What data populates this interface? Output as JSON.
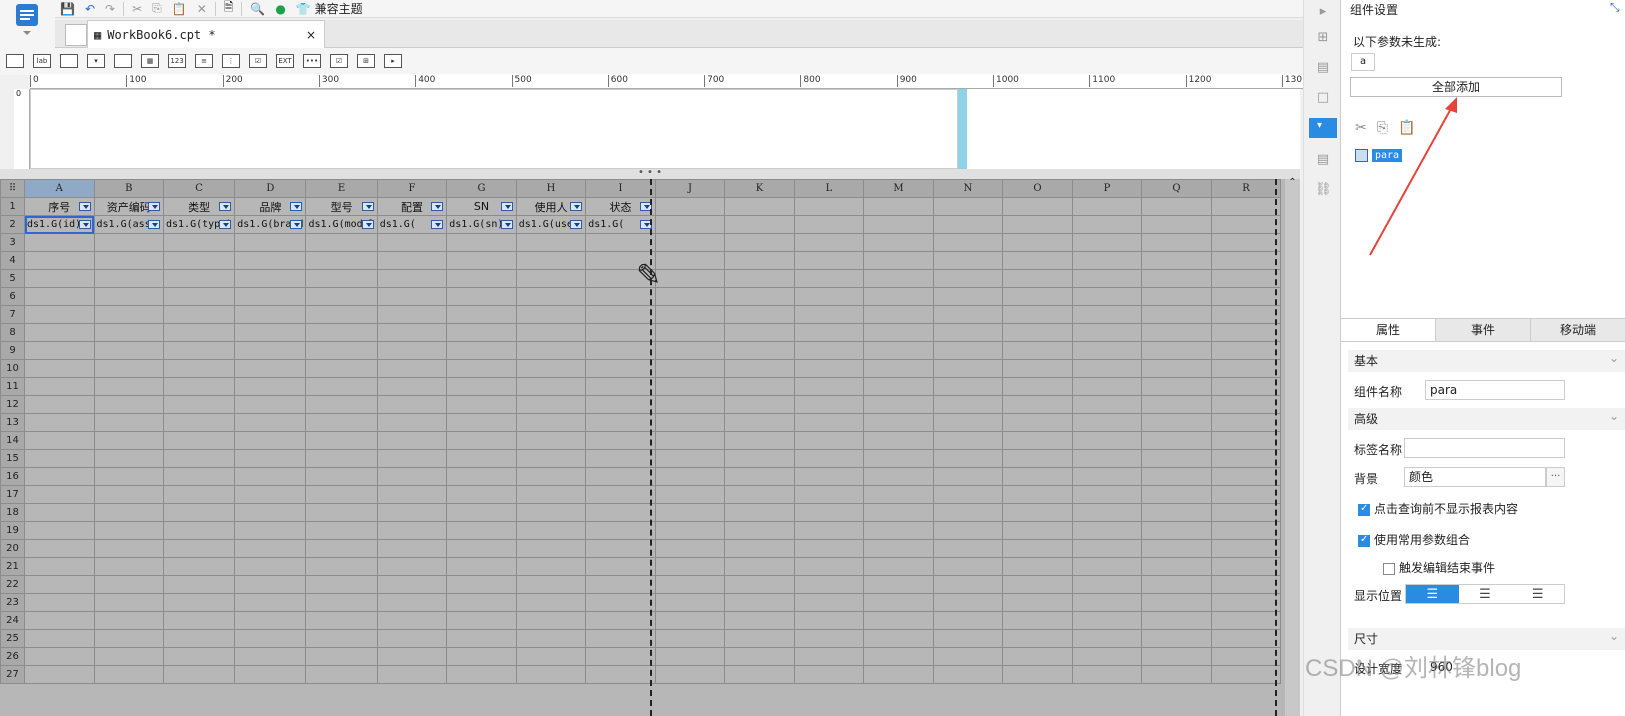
{
  "toolbar": {
    "theme_label": "兼容主题"
  },
  "tab": {
    "title": "WorkBook6.cpt *",
    "close": "×"
  },
  "ruler": {
    "ticks": [
      "0",
      "100",
      "200",
      "300",
      "400",
      "500",
      "600",
      "700",
      "800",
      "900",
      "1000",
      "1100",
      "1200",
      "130"
    ]
  },
  "vruler_label": "0",
  "splitter_dots": "• • •",
  "sheet": {
    "corner": "⠿",
    "columns": [
      "A",
      "B",
      "C",
      "D",
      "E",
      "F",
      "G",
      "H",
      "I",
      "J",
      "K",
      "L",
      "M",
      "N",
      "O",
      "P",
      "Q",
      "R"
    ],
    "headers": [
      "序号",
      "资产编码",
      "类型",
      "品牌",
      "型号",
      "配置",
      "SN",
      "使用人",
      "状态"
    ],
    "data_row": [
      "ds1.G(id)",
      "ds1.G(asse",
      "ds1.G(type)",
      "ds1.G(brand",
      "ds1.G(model",
      "ds1.G(",
      "ds1.G(sn)",
      "ds1.G(user",
      "ds1.G("
    ],
    "row_numbers": [
      "1",
      "2",
      "3",
      "4",
      "5",
      "6",
      "7",
      "8",
      "9",
      "10",
      "11",
      "12",
      "13",
      "14",
      "15",
      "16",
      "17",
      "18",
      "19",
      "20",
      "21",
      "22",
      "23",
      "24",
      "25",
      "26",
      "27"
    ]
  },
  "panel": {
    "title": "组件设置",
    "missing_params_label": "以下参数未生成:",
    "param_chip": "a",
    "add_all_button": "全部添加",
    "tree_item": "para",
    "tabs": [
      "属性",
      "事件",
      "移动端"
    ],
    "sections": {
      "basic": "基本",
      "advanced": "高级",
      "size": "尺寸"
    },
    "fields": {
      "name_label": "组件名称",
      "name_value": "para",
      "tag_label": "标签名称",
      "tag_value": "",
      "bg_label": "背景",
      "bg_value": "颜色",
      "bg_more": "···",
      "cb1": "点击查询前不显示报表内容",
      "cb2": "使用常用参数组合",
      "cb3": "触发编辑结束事件",
      "pos_label": "显示位置",
      "width_label": "设计宽度",
      "width_value": "960"
    },
    "checkbox_states": {
      "cb1": true,
      "cb2": true,
      "cb3": false
    },
    "accent_color": "#2a8be2"
  },
  "watermark": "CSDN @刘林锋blog"
}
